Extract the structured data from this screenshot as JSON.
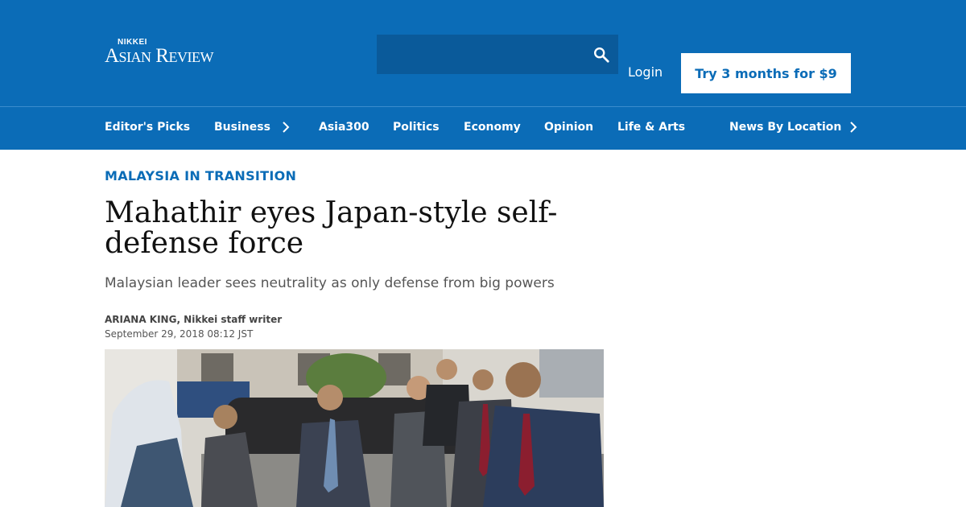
{
  "header": {
    "logo_top": "NIKKEI",
    "logo_main": "Asian Review",
    "search_placeholder": "",
    "login_label": "Login",
    "cta_label": "Try 3 months for $9",
    "brand_color": "#0b6cb7"
  },
  "nav": {
    "items": [
      {
        "label": "Editor's Picks"
      },
      {
        "label": "Business"
      },
      {
        "label": "Asia300"
      },
      {
        "label": "Politics"
      },
      {
        "label": "Economy"
      },
      {
        "label": "Opinion"
      },
      {
        "label": "Life & Arts"
      },
      {
        "label": "News By Location"
      }
    ]
  },
  "article": {
    "kicker": "MALAYSIA IN TRANSITION",
    "headline": "Mahathir eyes Japan-style self-defense force",
    "subheadline": "Malaysian leader sees neutrality as only defense from big powers",
    "author": "ARIANA KING, Nikkei staff writer",
    "date": "September 29, 2018 08:12 JST"
  },
  "icons": [
    "search-icon",
    "chevron-right-icon"
  ]
}
